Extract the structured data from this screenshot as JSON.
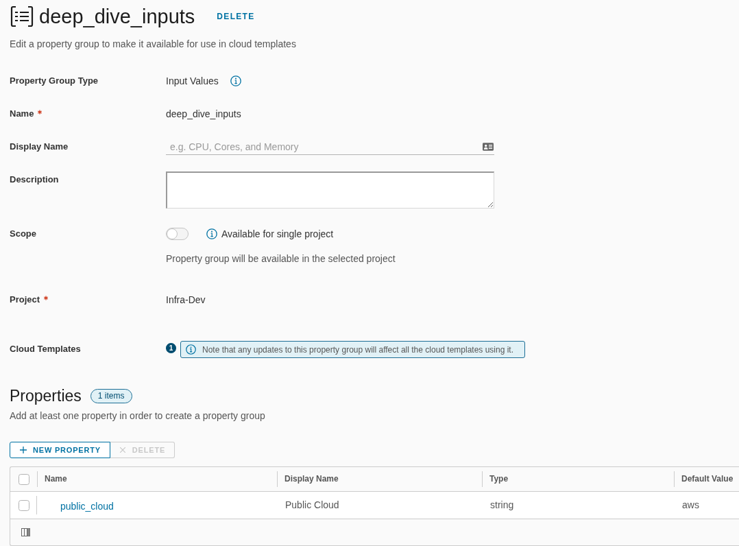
{
  "header": {
    "title": "deep_dive_inputs",
    "delete_action": "DELETE",
    "subtitle": "Edit a property group to make it available for use in cloud templates"
  },
  "form": [
    {
      "kind": "text",
      "label": "Property Group Type",
      "required": false,
      "value": "Input Values",
      "info": true
    },
    {
      "kind": "text",
      "label": "Name",
      "required": true,
      "value": "deep_dive_inputs",
      "info": false
    },
    {
      "kind": "input",
      "label": "Display Name",
      "required": false,
      "placeholder": "e.g. CPU, Cores, and Memory"
    },
    {
      "kind": "textarea",
      "label": "Description",
      "required": false
    },
    {
      "kind": "toggle",
      "label": "Scope",
      "required": false,
      "on": false,
      "toggle_label": "Available for single project",
      "helper": "Property group will be available in the selected project"
    },
    {
      "kind": "text",
      "label": "Project",
      "required": true,
      "value": "Infra-Dev",
      "info": false
    },
    {
      "kind": "alert",
      "label": "Cloud Templates",
      "required": false,
      "count": "1",
      "message": "Note that any updates to this property group will affect all the cloud templates using it."
    }
  ],
  "properties": {
    "title": "Properties",
    "badge": "1 items",
    "helper": "Add at least one property in order to create a property group",
    "buttons": [
      {
        "kind": "add",
        "label": "NEW PROPERTY",
        "disabled": false
      },
      {
        "kind": "delete",
        "label": "DELETE",
        "disabled": true
      }
    ],
    "table": {
      "select_all_checked": false,
      "columns": [
        "Name",
        "Display Name",
        "Type",
        "Default Value"
      ],
      "rows": [
        {
          "checked": false,
          "cells": [
            "public_cloud",
            "Public Cloud",
            "string",
            "aws"
          ]
        }
      ]
    }
  }
}
